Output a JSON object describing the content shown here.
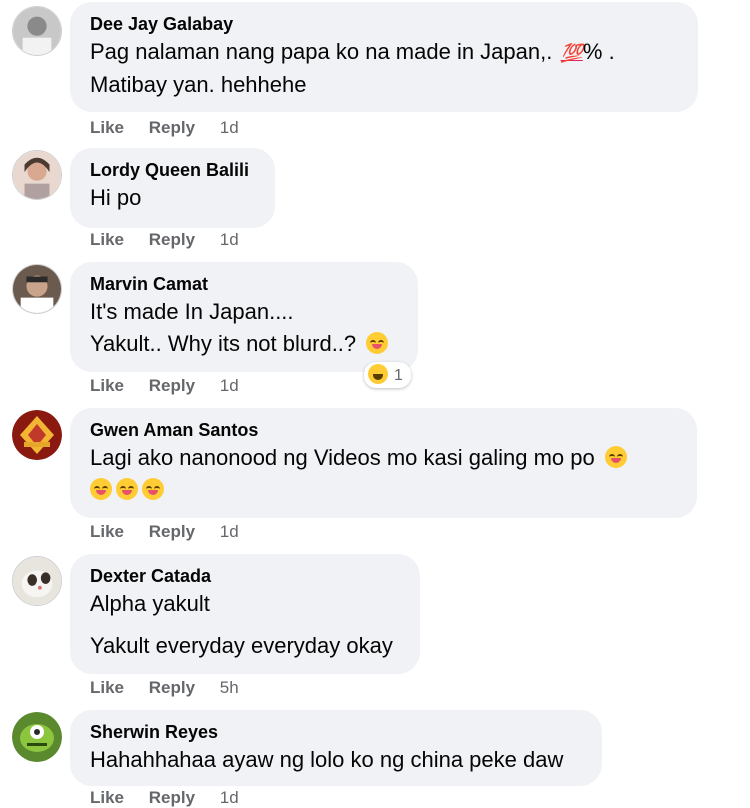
{
  "comments": [
    {
      "author": "Dee Jay Galabay",
      "lines": [
        "Pag nalaman nang papa ko na made in Japan,.",
        "Matibay yan. hehhehe"
      ],
      "hundred_emoji": "💯",
      "after_hundred": "% .",
      "like": "Like",
      "reply": "Reply",
      "time": "1d"
    },
    {
      "author": "Lordy Queen Balili",
      "lines": [
        "Hi po"
      ],
      "like": "Like",
      "reply": "Reply",
      "time": "1d"
    },
    {
      "author": "Marvin Camat",
      "lines": [
        "It's made In Japan....",
        "Yakult.. Why its not blurd..?"
      ],
      "reaction_count": "1",
      "like": "Like",
      "reply": "Reply",
      "time": "1d"
    },
    {
      "author": "Gwen Aman Santos",
      "lines": [
        "Lagi ako nanonood ng Videos mo kasi galing mo po"
      ],
      "like": "Like",
      "reply": "Reply",
      "time": "1d"
    },
    {
      "author": "Dexter Catada",
      "lines": [
        "Alpha yakult",
        "Yakult everyday everyday okay"
      ],
      "like": "Like",
      "reply": "Reply",
      "time": "5h"
    },
    {
      "author": "Sherwin Reyes",
      "lines": [
        "Hahahhahaa ayaw ng lolo ko ng china peke daw"
      ],
      "like": "Like",
      "reply": "Reply",
      "time": "1d"
    }
  ],
  "colors": {
    "bubble": "#f0f2f5",
    "meta": "#65676b",
    "text": "#050505"
  }
}
